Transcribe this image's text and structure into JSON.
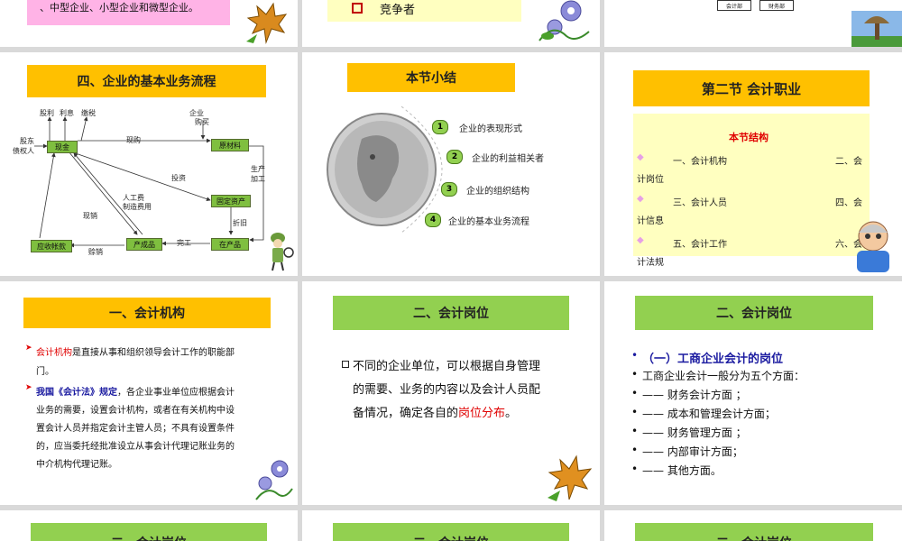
{
  "slide1": {
    "text": "、中型企业、小型企业和微型企业。"
  },
  "slide2": {
    "bullet_text": "竞争者"
  },
  "slide3": {
    "boxes": [
      "会计部",
      "财务部"
    ]
  },
  "slide4": {
    "title": "四、企业的基本业务流程",
    "nodes": {
      "cash": "现金",
      "material": "原材料",
      "fixed": "固定资产",
      "wip": "在产品",
      "product": "产成品",
      "ar": "应收帐款"
    },
    "labels": {
      "dividend": "股利",
      "interest": "利息",
      "tax": "缴税",
      "enterprise": "企业",
      "purchase_top": "购买",
      "shareholder": "股东",
      "creditor": "债权人",
      "purchase": "现购",
      "invest": "投资",
      "labor": "人工费",
      "mfg": "制造费用",
      "production": "生产",
      "process": "加工",
      "depreciation": "折旧",
      "cash_sale": "现销",
      "finish": "完工",
      "credit_sale": "赊销"
    }
  },
  "slide5": {
    "title": "本节小结",
    "items": [
      {
        "num": "1",
        "text": "企业的表现形式"
      },
      {
        "num": "2",
        "text": "企业的利益相关者"
      },
      {
        "num": "3",
        "text": "企业的组织结构"
      },
      {
        "num": "4",
        "text": "企业的基本业务流程"
      }
    ]
  },
  "slide6": {
    "title": "第二节  会计职业",
    "subtitle": "本节结构",
    "rows": [
      {
        "left": "一、会计机构",
        "right": "二、会",
        "wrap": "计岗位"
      },
      {
        "left": "三、会计人员",
        "right": "四、会",
        "wrap": "计信息"
      },
      {
        "left": "五、会计工作",
        "right": "六、会",
        "wrap": "计法规"
      }
    ]
  },
  "slide7": {
    "title": "一、会计机构",
    "p1_red": "会计机构",
    "p1_rest": "是直接从事和组织领导会计工作的职能部",
    "p1_line2": "门。",
    "p2_blue": "我国《会计法》规定",
    "p2_line1": "，各企业事业单位应根据会计",
    "p2_lines": [
      "业务的需要，设置会计机构，或者在有关机构中设",
      "置会计人员并指定会计主管人员；不具有设置条件",
      "的，应当委托经批准设立从事会计代理记账业务的",
      "中介机构代理记账。"
    ]
  },
  "slide8": {
    "title": "二、会计岗位",
    "line1": "不同的企业单位，可以根据自身管理",
    "line2": "的需要、业务的内容以及会计人员配",
    "line3_pre": "备情况，确定各自的",
    "line3_red": "岗位分布",
    "line3_post": "。"
  },
  "slide9": {
    "title": "二、会计岗位",
    "heading": "（一）工商企业会计的岗位",
    "lines": [
      "工商企业会计一般分为五个方面：",
      "—— 财务会计方面 ；",
      "——   成本和管理会计方面；",
      "——   财务管理方面 ；",
      "——   内部审计方面；",
      "—— 其他方面。"
    ]
  },
  "bottom": {
    "title1": "二、会计岗位",
    "title2": "二、会计岗位",
    "title3": "二、会计岗位"
  }
}
